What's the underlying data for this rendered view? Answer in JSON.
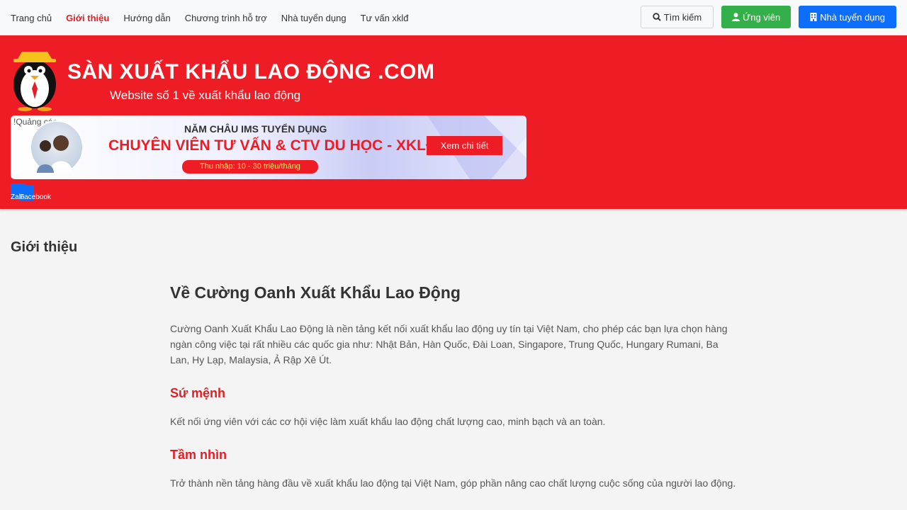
{
  "nav": {
    "links": [
      "Trang chủ",
      "Giới thiệu",
      "Hướng dẫn",
      "Chương trình hỗ trợ",
      "Nhà tuyển dụng",
      "Tư vấn xklđ"
    ],
    "active_index": 1,
    "search_label": "Tìm kiếm",
    "candidate_label": "Ứng viên",
    "employer_label": "Nhà tuyển dụng"
  },
  "header": {
    "logo_title": "SÀN XUẤT KHẨU LAO ĐỘNG .COM",
    "logo_subtitle": "Website số 1 về xuất khẩu lao động",
    "brand_color": "#ee1c25"
  },
  "banner": {
    "tag": "!Quảng cáo",
    "headline": "NĂM CHÂU IMS TUYỂN DỤNG",
    "main": "CHUYÊN VIÊN TƯ VẤN & CTV DU HỌC - XKLĐ",
    "income": "Thu nhập: 10 - 30 triệu/tháng",
    "cta": "Xem chi tiết"
  },
  "social": {
    "zalo": "Zalo",
    "facebook": "Facebook"
  },
  "page": {
    "heading": "Giới thiệu",
    "title": "Về Cường Oanh Xuất Khẩu Lao Động",
    "intro": "Cường Oanh Xuất Khẩu Lao Động là nền tảng kết nối xuất khẩu lao động uy tín tại Việt Nam, cho phép các bạn lựa chọn hàng ngàn công việc tại rất nhiều các quốc gia như: Nhật Bản, Hàn Quốc, Đài Loan, Singapore, Trung Quốc, Hungary Rumani, Ba Lan, Hy Lạp, Malaysia, Ả Rập Xê Út.",
    "mission_title": "Sứ mệnh",
    "mission_text": "Kết nối ứng viên với các cơ hội việc làm xuất khẩu lao động chất lượng cao, minh bạch và an toàn.",
    "vision_title": "Tầm nhìn",
    "vision_text": "Trở thành nền tảng hàng đầu về xuất khẩu lao động tại Việt Nam, góp phần nâng cao chất lượng cuộc sống của người lao động."
  }
}
